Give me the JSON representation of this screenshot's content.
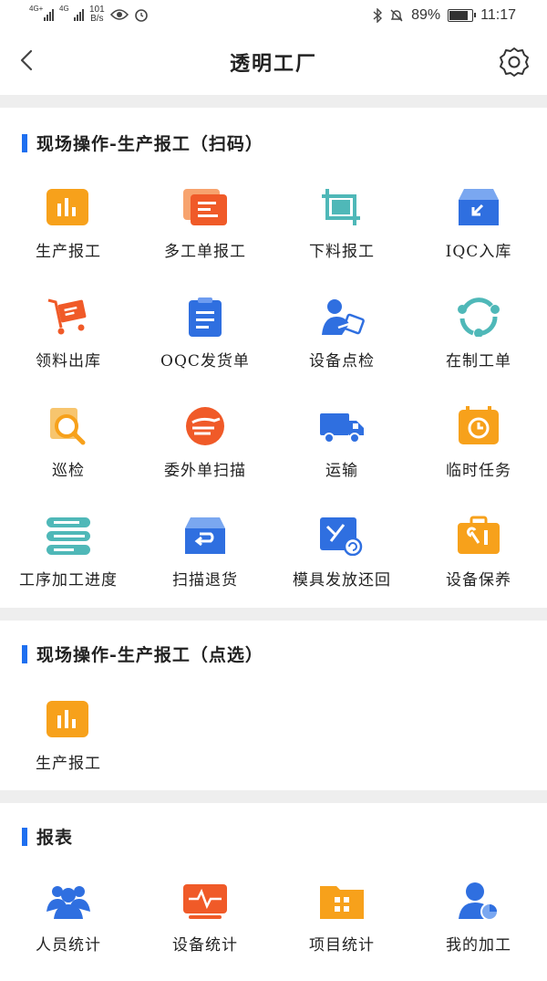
{
  "status_bar": {
    "net1": "4G+",
    "net2": "4G",
    "speed_value": "101",
    "speed_unit": "B/s",
    "battery_text": "89%",
    "battery_level": 0.89,
    "time": "11:17"
  },
  "nav": {
    "title": "透明工厂"
  },
  "sections": {
    "scan": {
      "title": "现场操作-生产报工（扫码）"
    },
    "select": {
      "title": "现场操作-生产报工（点选）"
    },
    "report": {
      "title": "报表"
    }
  },
  "scan_items": [
    {
      "label": "生产报工",
      "icon": "bar-chart-icon"
    },
    {
      "label": "多工单报工",
      "icon": "documents-icon"
    },
    {
      "label": "下料报工",
      "icon": "crop-icon"
    },
    {
      "label": "IQC入库",
      "icon": "inbox-icon"
    },
    {
      "label": "领料出库",
      "icon": "cart-icon"
    },
    {
      "label": "OQC发货单",
      "icon": "clipboard-icon"
    },
    {
      "label": "设备点检",
      "icon": "inspector-icon"
    },
    {
      "label": "在制工单",
      "icon": "cycle-icon"
    },
    {
      "label": "巡检",
      "icon": "magnifier-icon"
    },
    {
      "label": "委外单扫描",
      "icon": "outsource-icon"
    },
    {
      "label": "运输",
      "icon": "truck-icon"
    },
    {
      "label": "临时任务",
      "icon": "clock-icon"
    },
    {
      "label": "工序加工进度",
      "icon": "progress-icon"
    },
    {
      "label": "扫描退货",
      "icon": "return-box-icon"
    },
    {
      "label": "模具发放还回",
      "icon": "mold-icon"
    },
    {
      "label": "设备保养",
      "icon": "toolbox-icon"
    }
  ],
  "select_items": [
    {
      "label": "生产报工",
      "icon": "bar-chart-icon"
    }
  ],
  "report_items": [
    {
      "label": "人员统计",
      "icon": "people-icon"
    },
    {
      "label": "设备统计",
      "icon": "monitor-icon"
    },
    {
      "label": "项目统计",
      "icon": "folder-icon"
    },
    {
      "label": "我的加工",
      "icon": "user-chart-icon"
    }
  ],
  "colors": {
    "accent_bar": "#1e6ff0",
    "orange": "#f7a11b",
    "red_orange": "#f05a28",
    "teal": "#4fb8b8",
    "blue": "#2f6fe0"
  }
}
